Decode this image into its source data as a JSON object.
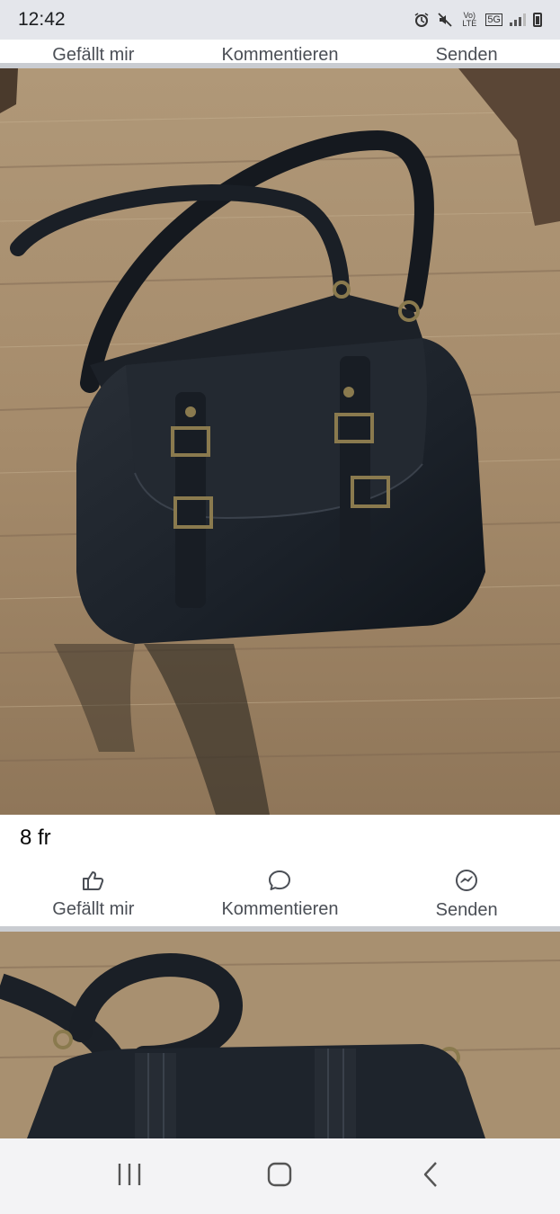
{
  "status_bar": {
    "time": "12:42",
    "icons": [
      "alarm-icon",
      "mute-icon",
      "volte-icon",
      "5g-icon",
      "signal-icon",
      "battery-icon"
    ],
    "volte_label": "Vo) LTE",
    "network_label": "5G"
  },
  "post_top": {
    "actions": {
      "like_label": "Gefällt mir",
      "comment_label": "Kommentieren",
      "send_label": "Senden"
    }
  },
  "post": {
    "text": "8 fr",
    "actions": {
      "like_label": "Gefällt mir",
      "comment_label": "Kommentieren",
      "send_label": "Senden"
    }
  },
  "nav_bar": {
    "buttons": [
      "recent-apps-icon",
      "home-icon",
      "back-icon"
    ]
  },
  "colors": {
    "background": "#ffffff",
    "divider": "#c9ccd1",
    "action_text": "#4b4f56",
    "floor_wood": "#a48a6c",
    "bag_leather": "#1d232b"
  }
}
